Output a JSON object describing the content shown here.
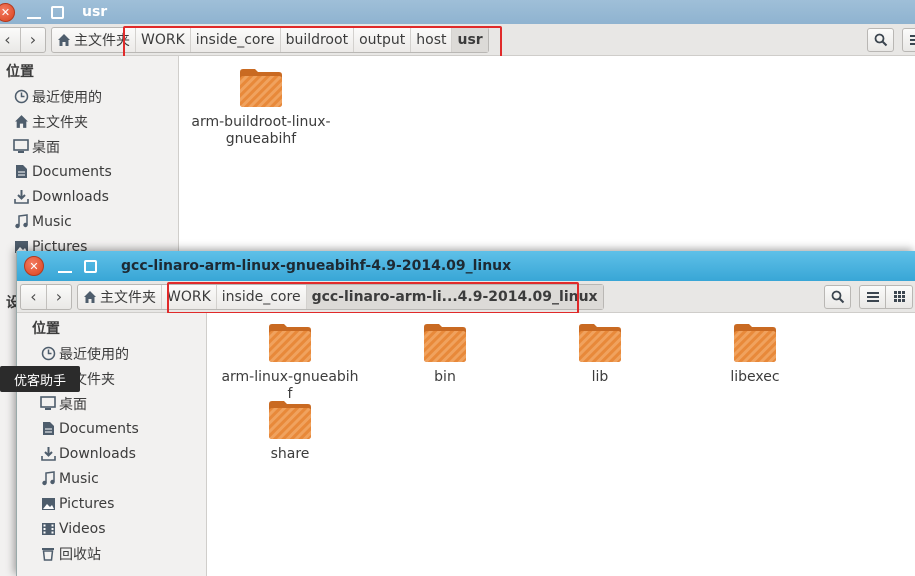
{
  "back_window": {
    "title": "usr",
    "breadcrumb": {
      "home_label": "主文件夹",
      "items": [
        "WORK",
        "inside_core",
        "buildroot",
        "output",
        "host",
        "usr"
      ]
    },
    "sidebar": {
      "heading": "位置",
      "items": [
        {
          "label": "最近使用的",
          "icon": "clock-icon"
        },
        {
          "label": "主文件夹",
          "icon": "home-icon"
        },
        {
          "label": "桌面",
          "icon": "desktop-icon"
        },
        {
          "label": "Documents",
          "icon": "document-icon"
        },
        {
          "label": "Downloads",
          "icon": "download-icon"
        },
        {
          "label": "Music",
          "icon": "music-icon"
        },
        {
          "label": "Pictures",
          "icon": "pictures-icon"
        }
      ],
      "partial_label": "设"
    },
    "files": [
      {
        "name": "arm-buildroot-linux-gnueabihf"
      }
    ]
  },
  "front_window": {
    "title": "gcc-linaro-arm-linux-gnueabihf-4.9-2014.09_linux",
    "breadcrumb": {
      "home_label": "主文件夹",
      "items": [
        "WORK",
        "inside_core",
        "gcc-linaro-arm-li...4.9-2014.09_linux"
      ]
    },
    "sidebar": {
      "heading": "位置",
      "items": [
        {
          "label": "最近使用的",
          "icon": "clock-icon"
        },
        {
          "label": "主文件夹",
          "icon": "home-icon"
        },
        {
          "label": "桌面",
          "icon": "desktop-icon"
        },
        {
          "label": "Documents",
          "icon": "document-icon"
        },
        {
          "label": "Downloads",
          "icon": "download-icon"
        },
        {
          "label": "Music",
          "icon": "music-icon"
        },
        {
          "label": "Pictures",
          "icon": "pictures-icon"
        },
        {
          "label": "Videos",
          "icon": "videos-icon"
        },
        {
          "label": "回收站",
          "icon": "trash-icon"
        }
      ]
    },
    "files": [
      {
        "name": "arm-linux-gnueabihf"
      },
      {
        "name": "bin"
      },
      {
        "name": "lib"
      },
      {
        "name": "libexec"
      },
      {
        "name": "share"
      }
    ]
  },
  "tooltip": {
    "text": "优客助手"
  },
  "colors": {
    "highlight_box": "#e02a2a",
    "folder_orange": "#e8893a",
    "active_titlebar": "#38a6d6",
    "inactive_titlebar": "#8fb3d0"
  }
}
